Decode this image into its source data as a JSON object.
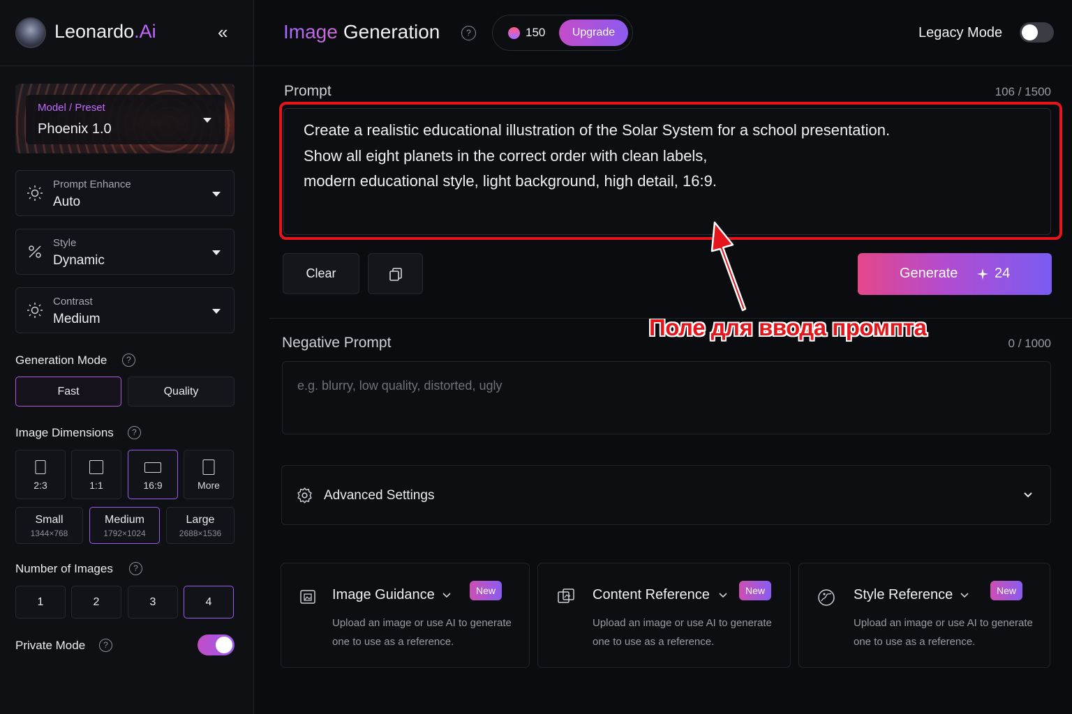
{
  "brand": {
    "name": "Leonardo",
    "suffix": ".Ai"
  },
  "header": {
    "title_part1": "Image",
    "title_part2": "Generation",
    "tokens": "150",
    "upgrade_label": "Upgrade",
    "legacy_label": "Legacy Mode",
    "legacy_enabled": false
  },
  "sidebar": {
    "model": {
      "label": "Model / Preset",
      "value": "Phoenix 1.0"
    },
    "prompt_enhance": {
      "label": "Prompt Enhance",
      "value": "Auto"
    },
    "style": {
      "label": "Style",
      "value": "Dynamic"
    },
    "contrast": {
      "label": "Contrast",
      "value": "Medium"
    },
    "generation_mode": {
      "label": "Generation Mode",
      "options": [
        "Fast",
        "Quality"
      ],
      "selected": "Fast"
    },
    "image_dimensions": {
      "label": "Image Dimensions",
      "ratios": [
        "2:3",
        "1:1",
        "16:9",
        "More"
      ],
      "selected_ratio": "16:9",
      "sizes": [
        {
          "name": "Small",
          "res": "1344×768"
        },
        {
          "name": "Medium",
          "res": "1792×1024"
        },
        {
          "name": "Large",
          "res": "2688×1536"
        }
      ],
      "selected_size": "Medium"
    },
    "number_of_images": {
      "label": "Number of Images",
      "options": [
        "1",
        "2",
        "3",
        "4"
      ],
      "selected": "4"
    },
    "private_mode": {
      "label": "Private Mode",
      "enabled": true
    }
  },
  "prompt": {
    "label": "Prompt",
    "counter": "106 / 1500",
    "lines": [
      "Create a realistic educational illustration of the Solar System for a school presentation.",
      "Show all eight planets in the correct order with clean labels,",
      "modern educational style, light background, high detail, 16:9."
    ]
  },
  "actions": {
    "clear_label": "Clear",
    "generate_label": "Generate",
    "generate_cost": "24"
  },
  "negative_prompt": {
    "label": "Negative Prompt",
    "counter": "0 / 1000",
    "placeholder": "e.g. blurry, low quality, distorted, ugly"
  },
  "advanced": {
    "label": "Advanced Settings"
  },
  "references": [
    {
      "title": "Image Guidance",
      "badge": "New",
      "description": "Upload an image or use AI to generate one to use as a reference."
    },
    {
      "title": "Content Reference",
      "badge": "New",
      "description": "Upload an image or use AI to generate one to use as a reference."
    },
    {
      "title": "Style Reference",
      "badge": "New",
      "description": "Upload an image or use AI to generate one to use as a reference."
    }
  ],
  "annotation": {
    "text": "Поле для ввода промпта",
    "color": "#e4161c"
  },
  "colors": {
    "accent": "#9b5cf0",
    "brand_pink": "#c268ff",
    "highlight": "#e4161c"
  }
}
